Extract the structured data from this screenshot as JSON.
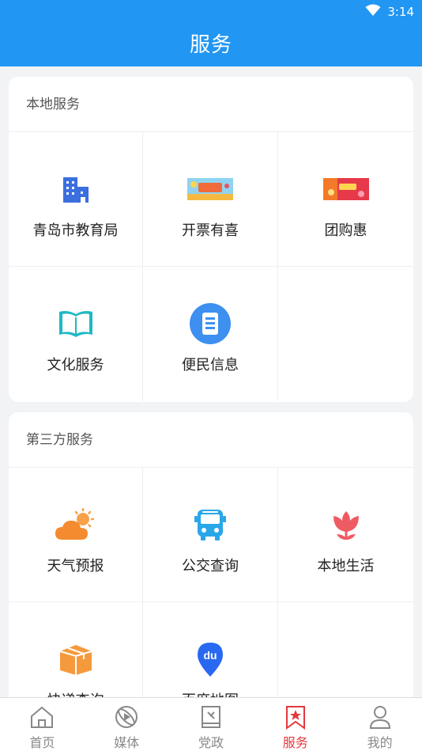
{
  "status_bar": {
    "time": "3:14",
    "wifi_icon": "wifi-icon"
  },
  "header": {
    "title": "服务"
  },
  "local_services": {
    "title": "本地服务",
    "items": [
      {
        "label": "青岛市教育局",
        "icon": "building-icon"
      },
      {
        "label": "开票有喜",
        "icon": "banner-image"
      },
      {
        "label": "团购惠",
        "icon": "banner-image"
      },
      {
        "label": "文化服务",
        "icon": "book-icon"
      },
      {
        "label": "便民信息",
        "icon": "document-icon"
      }
    ]
  },
  "third_party_services": {
    "title": "第三方服务",
    "items": [
      {
        "label": "天气预报",
        "icon": "weather-icon"
      },
      {
        "label": "公交查询",
        "icon": "bus-icon"
      },
      {
        "label": "本地生活",
        "icon": "flower-icon"
      },
      {
        "label": "快递查询",
        "icon": "package-icon"
      },
      {
        "label": "百度地图",
        "icon": "map-pin-icon"
      }
    ]
  },
  "tabbar": {
    "active_color": "#e4393c",
    "items": [
      {
        "label": "首页",
        "icon": "home-icon",
        "active": false
      },
      {
        "label": "媒体",
        "icon": "media-icon",
        "active": false
      },
      {
        "label": "党政",
        "icon": "book-icon",
        "active": false
      },
      {
        "label": "服务",
        "icon": "bookmark-star-icon",
        "active": true
      },
      {
        "label": "我的",
        "icon": "user-icon",
        "active": false
      }
    ]
  }
}
